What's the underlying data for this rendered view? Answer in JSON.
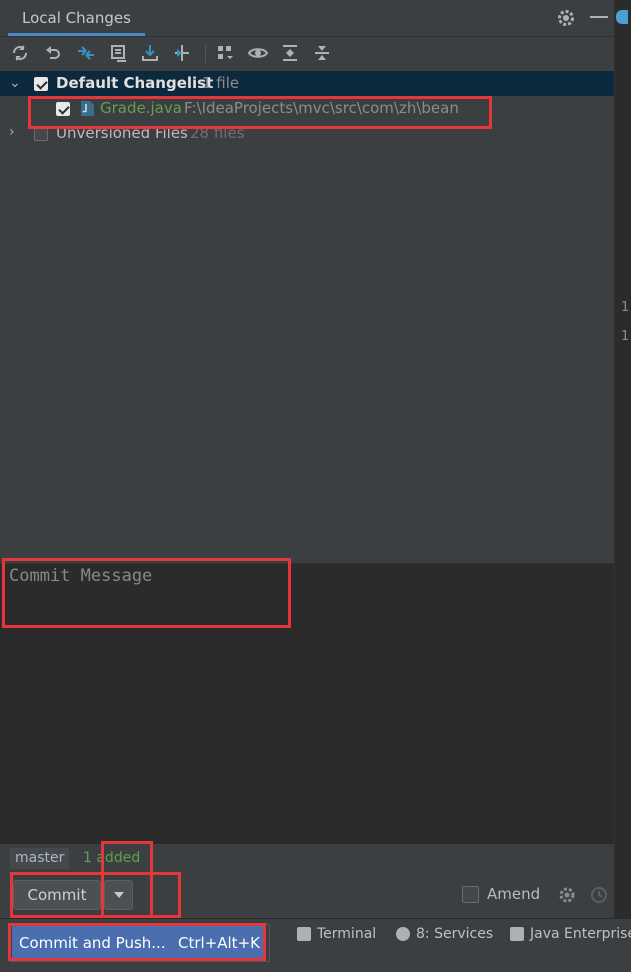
{
  "header": {
    "tab_label": "Local Changes"
  },
  "toolbar": {
    "buttons": [
      "refresh-icon",
      "rollback-icon",
      "show-diff-icon",
      "shelve-icon",
      "update-icon",
      "group-by-icon",
      "expand-icon",
      "eye-icon",
      "expand-all-icon",
      "collapse-all-icon"
    ]
  },
  "tree": {
    "changelist": {
      "name": "Default Changelist",
      "count": "1 file",
      "checked": true
    },
    "file": {
      "name": "Grade.java",
      "path": "F:\\IdeaProjects\\mvc\\src\\com\\zh\\bean",
      "checked": true
    },
    "unversioned": {
      "name": "Unversioned Files",
      "count": "28 files",
      "checked": false
    }
  },
  "right_strip": {
    "line1": "1",
    "line2": "1"
  },
  "commit": {
    "placeholder": "Commit Message",
    "branch": "master",
    "added": "1 added",
    "commit_label": "Commit",
    "amend_label": "Amend"
  },
  "popup": {
    "label": "Commit and Push...",
    "shortcut": "Ctrl+Alt+K"
  },
  "statusbar": {
    "terminal": "Terminal",
    "services": "8: Services",
    "java_enterprise": "Java Enterprise"
  },
  "colors": {
    "accent": "#4b6eaf",
    "highlight_box": "#e5373b",
    "added_green": "#62a04c",
    "file_green": "#62a04c"
  }
}
